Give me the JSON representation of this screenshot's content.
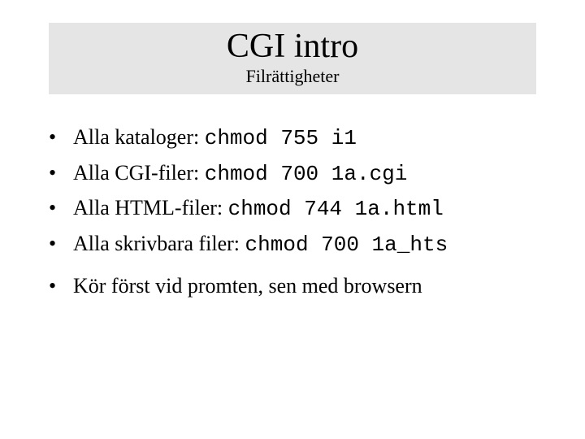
{
  "header": {
    "title": "CGI intro",
    "subtitle": "Filrättigheter"
  },
  "bullets": [
    {
      "prefix": "Alla kataloger: ",
      "cmd": "chmod 755 i1"
    },
    {
      "prefix": "Alla CGI-filer: ",
      "cmd": "chmod 700 1a.cgi"
    },
    {
      "prefix": "Alla HTML-filer: ",
      "cmd": "chmod 744 1a.html"
    },
    {
      "prefix": "Alla skrivbara filer: ",
      "cmd": "chmod 700 1a_hts"
    }
  ],
  "final_line": "Kör först vid promten, sen med browsern"
}
